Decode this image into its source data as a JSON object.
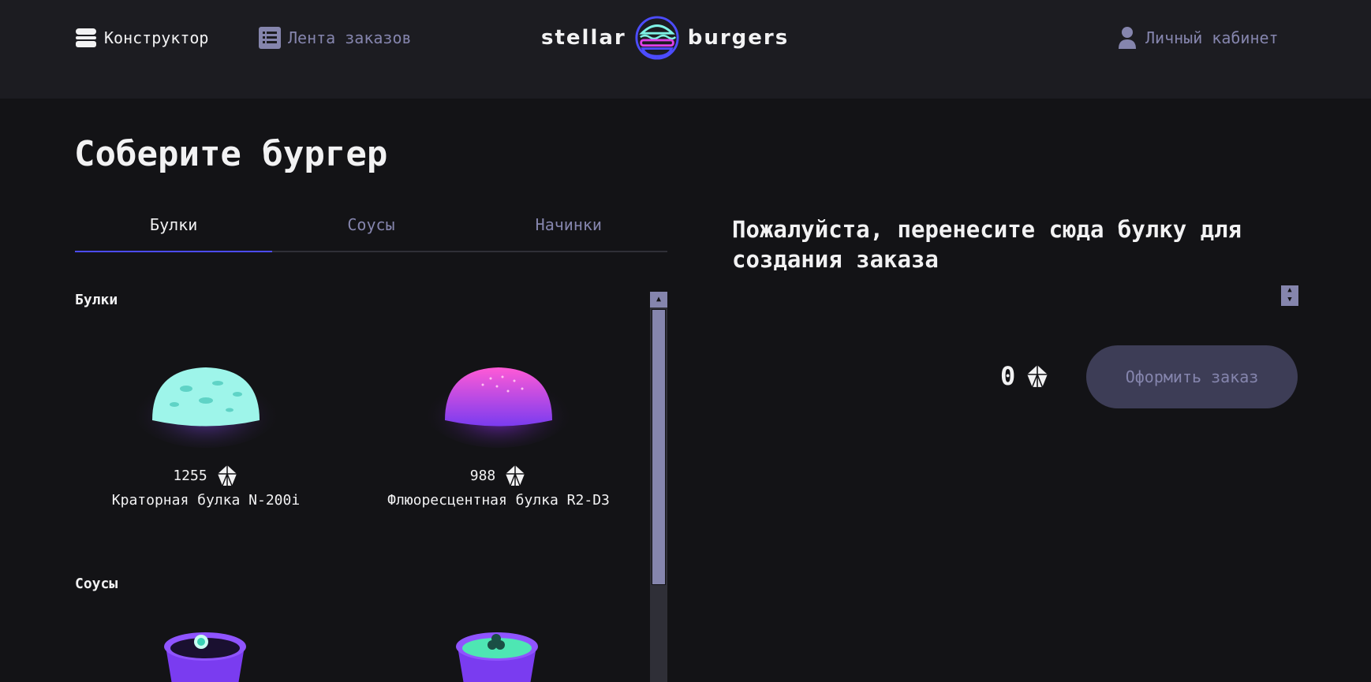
{
  "header": {
    "nav_constructor": "Конструктор",
    "nav_feed": "Лента заказов",
    "logo_left": "stellar",
    "logo_right": "burgers",
    "nav_account": "Личный кабинет"
  },
  "main": {
    "title": "Соберите бургер",
    "tabs": [
      {
        "label": "Булки",
        "active": true
      },
      {
        "label": "Соусы",
        "active": false
      },
      {
        "label": "Начинки",
        "active": false
      }
    ],
    "sections": [
      {
        "title": "Булки",
        "items": [
          {
            "price": "1255",
            "name": "Краторная булка N-200i",
            "color": "#7ff3e6"
          },
          {
            "price": "988",
            "name": "Флюоресцентная булка R2-D3",
            "color": "#e040e8"
          }
        ]
      },
      {
        "title": "Соусы",
        "items": []
      }
    ]
  },
  "constructor": {
    "hint": "Пожалуйста, перенесите сюда булку для создания заказа",
    "total": "0",
    "order_button": "Оформить заказ"
  },
  "colors": {
    "accent": "#4c4cff",
    "inactive": "#8585ad",
    "background": "#131316",
    "header_bg": "#1c1c21"
  }
}
